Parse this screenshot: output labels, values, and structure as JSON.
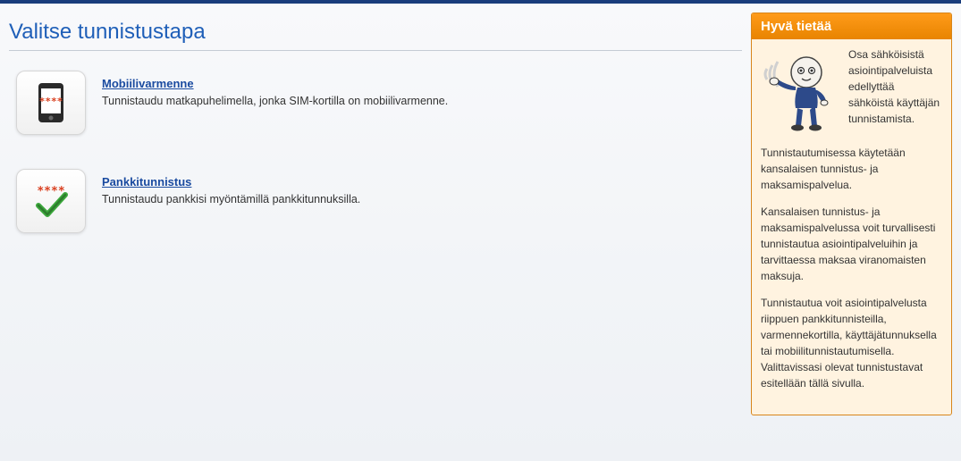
{
  "page": {
    "title": "Valitse tunnistustapa"
  },
  "options": {
    "mobile": {
      "link": "Mobiilivarmenne",
      "desc": "Tunnistaudu matkapuhelimella, jonka SIM-kortilla on mobiilivarmenne."
    },
    "bank": {
      "link": "Pankkitunnistus",
      "desc": "Tunnistaudu pankkisi myöntämillä pankkitunnuksilla."
    }
  },
  "sidebar": {
    "title": "Hyvä tietää",
    "intro": "Osa sähköisistä asiointipalveluista edellyttää sähköistä käyttäjän tunnistamista.",
    "p1cont": "Tunnistautumisessa käytetään kansalaisen tunnistus- ja maksamispalvelua.",
    "p2": "Kansalaisen tunnistus- ja maksamispalvelussa voit turvallisesti tunnistautua asiointipalveluihin ja tarvittaessa maksaa viranomaisten maksuja.",
    "p3": "Tunnistautua voit asiointipalvelusta riippuen pankkitunnisteilla, varmennekortilla, käyttäjätunnuksella tai mobiilitunnistautumisella. Valittavissasi olevat tunnistustavat esitellään tällä sivulla."
  }
}
